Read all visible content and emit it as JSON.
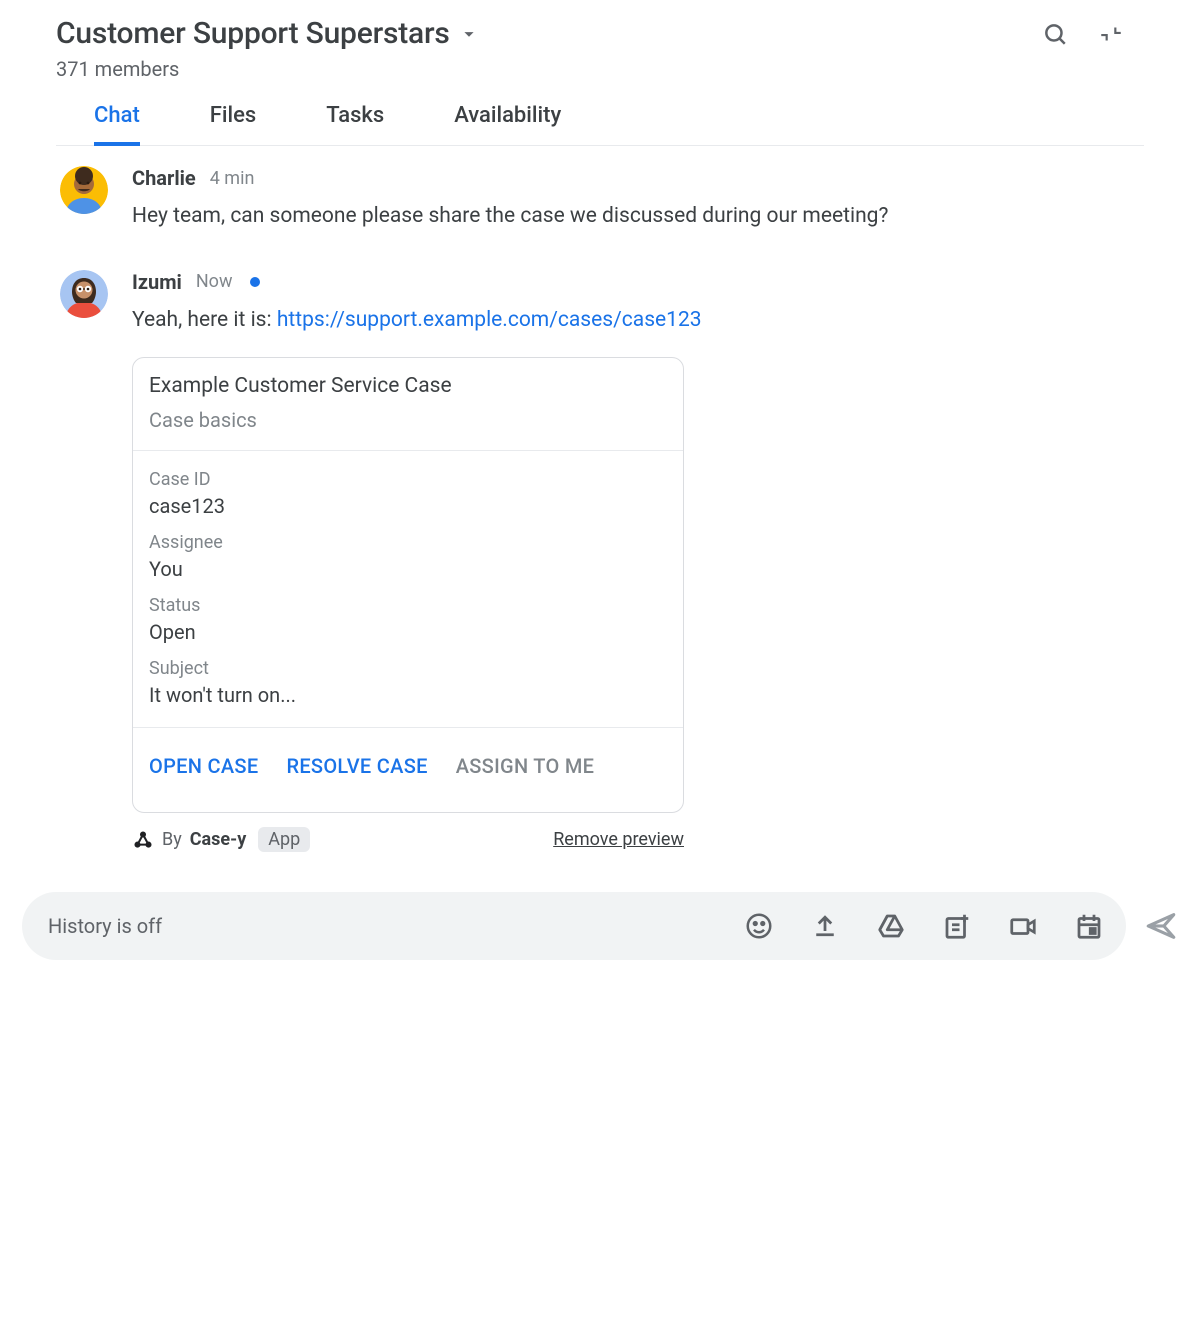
{
  "header": {
    "title": "Customer Support Superstars",
    "members": "371 members"
  },
  "tabs": [
    {
      "label": "Chat",
      "active": true
    },
    {
      "label": "Files",
      "active": false
    },
    {
      "label": "Tasks",
      "active": false
    },
    {
      "label": "Availability",
      "active": false
    }
  ],
  "messages": [
    {
      "author": "Charlie",
      "time": "4 min",
      "unread": false,
      "text": "Hey team, can someone please share the case we discussed during our meeting?"
    },
    {
      "author": "Izumi",
      "time": "Now",
      "unread": true,
      "text_prefix": "Yeah, here it is: ",
      "link": "https://support.example.com/cases/case123",
      "card": {
        "title": "Example Customer Service Case",
        "subtitle": "Case basics",
        "fields": [
          {
            "label": "Case ID",
            "value": "case123"
          },
          {
            "label": "Assignee",
            "value": "You"
          },
          {
            "label": "Status",
            "value": "Open"
          },
          {
            "label": "Subject",
            "value": "It won't turn on..."
          }
        ],
        "actions": [
          {
            "label": "OPEN CASE",
            "disabled": false
          },
          {
            "label": "RESOLVE CASE",
            "disabled": false
          },
          {
            "label": "ASSIGN TO ME",
            "disabled": true
          }
        ],
        "meta_by": "By",
        "meta_app": "Case-y",
        "meta_badge": "App",
        "remove": "Remove preview"
      }
    }
  ],
  "composer": {
    "placeholder": "History is off"
  }
}
